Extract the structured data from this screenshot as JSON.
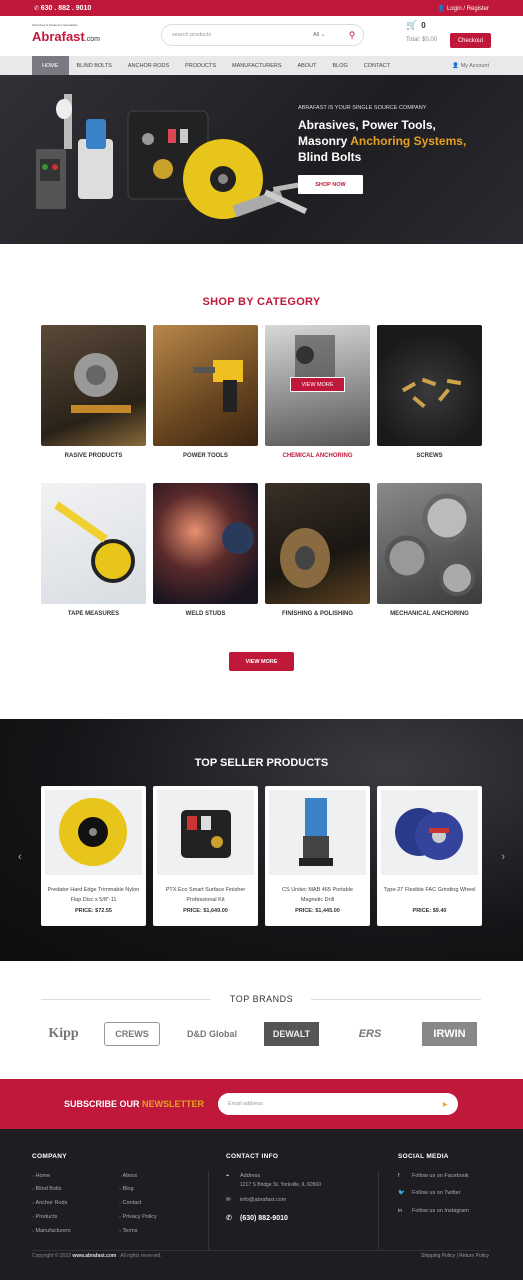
{
  "topbar": {
    "phone": "630 . 882 . 9010",
    "login": "Login / Register"
  },
  "header": {
    "tagline": "Abrasives & Fasteners Specialists",
    "logo": "Abrafast",
    "logo_suffix": ".com",
    "search_placeholder": "search products",
    "search_category": "All",
    "cart_count": "0",
    "cart_total": "Total: $0.00",
    "checkout": "Checkout"
  },
  "nav": {
    "items": [
      "HOME",
      "BLIND BOLTS",
      "ANCHOR RODS",
      "PRODUCTS",
      "MANUFACTURERS",
      "ABOUT",
      "BLOG",
      "CONTACT"
    ],
    "account": "My Account"
  },
  "hero": {
    "tagline": "ABRAFAST IS YOUR SINGLE SOURCE COMPANY",
    "line1": "Abrasives, Power Tools,",
    "line2a": "Masonry ",
    "line2b": "Anchoring Systems,",
    "line3": "Blind Bolts",
    "button": "SHOP NOW"
  },
  "categories": {
    "title": "SHOP BY CATEGORY",
    "items": [
      "RASIVE PRODUCTS",
      "POWER TOOLS",
      "CHEMICAL ANCHORING",
      "SCREWS",
      "TAPE MEASURES",
      "WELD STUDS",
      "FINISHING & POLISHING",
      "MECHANICAL ANCHORING"
    ],
    "overlay": "VIEW MORE",
    "view_more": "VIEW MORE"
  },
  "sellers": {
    "title": "TOP SELLER PRODUCTS",
    "products": [
      {
        "name": "Predator Hard Edge Trimmable Nylon Flap Disc x 5/8\"-11",
        "price_label": "PRICE:",
        "price": "$72.55"
      },
      {
        "name": "PTX Eco Smart Surface Finisher Professional Kit",
        "price_label": "PRICE:",
        "price": "$1,649.00"
      },
      {
        "name": "CS Unitec MAB 465 Portable Magnetic Drill",
        "price_label": "PRICE:",
        "price": "$1,445.00"
      },
      {
        "name": "Type-27 Flexible FAC Grinding Wheel",
        "price_label": "PRICE:",
        "price": "$9.40"
      }
    ]
  },
  "brands": {
    "title": "TOP BRANDS",
    "items": [
      "Kipp",
      "CREWS",
      "D&D Global",
      "DEWALT",
      "ERS",
      "IRWIN"
    ]
  },
  "newsletter": {
    "label_a": "SUBSCRIBE OUR ",
    "label_b": "NEWSLETTER",
    "placeholder": "Email address"
  },
  "footer": {
    "company": {
      "title": "COMPANY",
      "col1": [
        "Home",
        "Blind Bolts",
        "Anchor Rods",
        "Products",
        "Manufacturers"
      ],
      "col2": [
        "About",
        "Blog",
        "Contact",
        "Privacy Policy",
        "Terms"
      ]
    },
    "contact": {
      "title": "CONTACT INFO",
      "address_label": "Address",
      "address": "1217 S Bridge St, Yorkville, IL 60560",
      "email": "info@abrafast.com",
      "phone": "(630) 882-9010"
    },
    "social": {
      "title": "SOCIAL MEDIA",
      "items": [
        "Follow us on Facebook",
        "Follow us on Twitter",
        "Follow us on Instagram"
      ]
    },
    "copyright_a": "Copyright © 2022 ",
    "copyright_site": "www.abrafast.com",
    "copyright_b": " . All rights reserved.",
    "policy1": "Shipping Policy",
    "sep": "|",
    "policy2": "Return Policy"
  },
  "colors": {
    "brand": "#c0183a",
    "accent": "#e5a021",
    "footer": "#1f1d22"
  }
}
